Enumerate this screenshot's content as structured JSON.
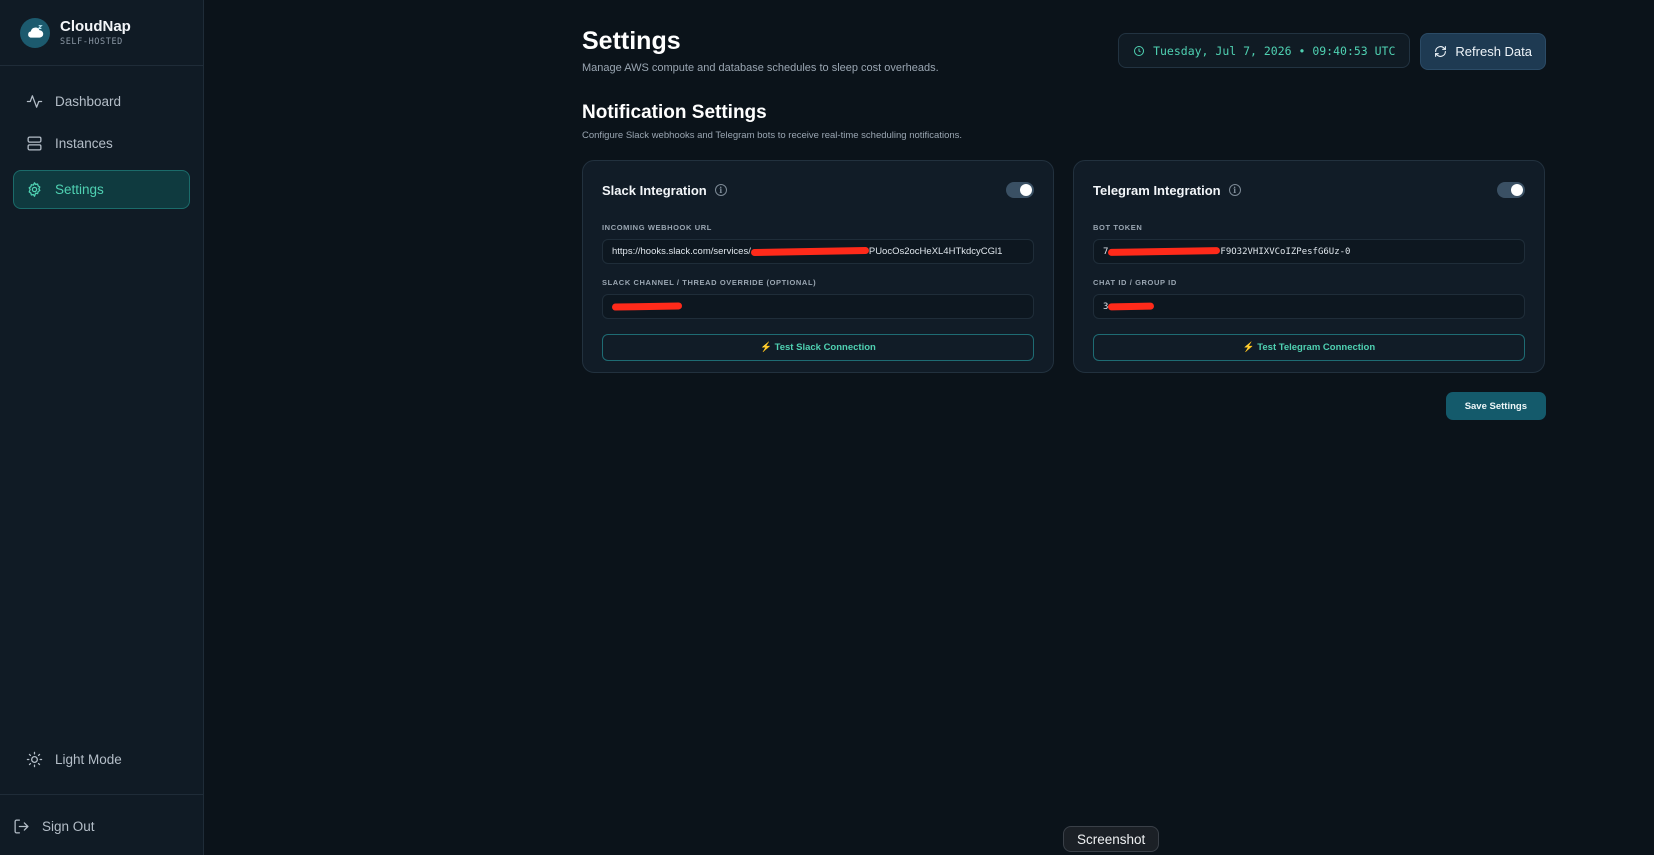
{
  "brand": {
    "name": "CloudNap",
    "subtitle": "SELF-HOSTED"
  },
  "sidebar": {
    "items": [
      {
        "label": "Dashboard",
        "icon": "activity-icon"
      },
      {
        "label": "Instances",
        "icon": "server-icon"
      },
      {
        "label": "Settings",
        "icon": "gear-icon",
        "active": true
      }
    ],
    "light_mode_label": "Light Mode",
    "sign_out_label": "Sign Out"
  },
  "header": {
    "title": "Settings",
    "subtitle": "Manage AWS compute and database schedules to sleep cost overheads.",
    "datetime": "Tuesday, Jul 7, 2026 • 09:40:53 UTC",
    "refresh_label": "Refresh Data"
  },
  "notifications": {
    "title": "Notification Settings",
    "subtitle": "Configure Slack webhooks and Telegram bots to receive real-time scheduling notifications.",
    "slack": {
      "title": "Slack Integration",
      "enabled": true,
      "webhook_label": "INCOMING WEBHOOK URL",
      "webhook_prefix": "https://hooks.slack.com/services/",
      "webhook_suffix": "PUocOs2ocHeXL4HTkdcyCGl1",
      "channel_label": "SLACK CHANNEL / THREAD OVERRIDE (OPTIONAL)",
      "test_label": "⚡ Test Slack Connection"
    },
    "telegram": {
      "title": "Telegram Integration",
      "enabled": true,
      "token_label": "BOT TOKEN",
      "token_prefix": "7",
      "token_suffix": "F9O32VHIXVCoIZPesfG6Uz-0",
      "chat_label": "CHAT ID / GROUP ID",
      "chat_prefix": "3",
      "test_label": "⚡ Test Telegram Connection"
    },
    "save_label": "Save Settings"
  },
  "overlay": {
    "screenshot_label": "Screenshot"
  },
  "colors": {
    "accent": "#4fd1b2",
    "redaction": "#ff2a1a",
    "background": "#0b131a"
  }
}
